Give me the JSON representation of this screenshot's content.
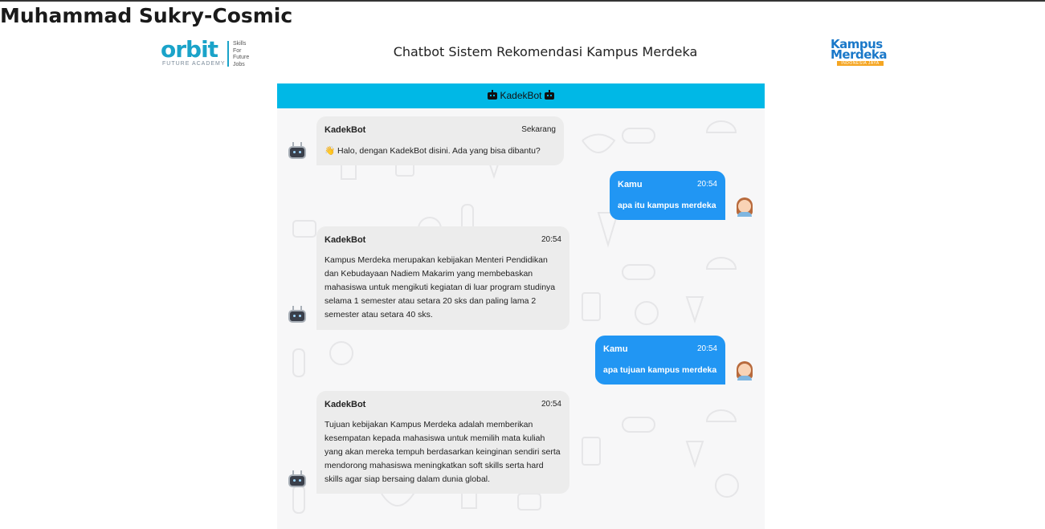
{
  "page": {
    "title": "Muhammad Sukry-Cosmic"
  },
  "header": {
    "orbit_logo": {
      "name": "orbit",
      "sub": "FUTURE ACADEMY",
      "tagline": [
        "Skills",
        "For",
        "Future",
        "Jobs"
      ]
    },
    "title": "Chatbot Sistem Rekomendasi Kampus Merdeka",
    "km_logo": {
      "line1": "Kampus",
      "line2": "Merdeka",
      "strip": "INDONESIA JAYA"
    }
  },
  "chat": {
    "header_label": "KadekBot",
    "header_icon": "robot-icon",
    "colors": {
      "header": "#00b8e6",
      "user_bubble": "#2196f3",
      "bot_bubble": "#ececec"
    },
    "messages": [
      {
        "sender": "KadekBot",
        "time": "Sekarang",
        "side": "left",
        "emoji": "👋",
        "text": "Halo, dengan KadekBot disini. Ada yang bisa dibantu?"
      },
      {
        "sender": "Kamu",
        "time": "20:54",
        "side": "right",
        "text": "apa itu kampus merdeka"
      },
      {
        "sender": "KadekBot",
        "time": "20:54",
        "side": "left",
        "text": "Kampus Merdeka merupakan kebijakan Menteri Pendidikan dan Kebudayaan Nadiem Makarim yang membebaskan mahasiswa untuk mengikuti kegiatan di luar program studinya selama 1 semester atau setara 20 sks dan paling lama 2 semester atau setara 40 sks."
      },
      {
        "sender": "Kamu",
        "time": "20:54",
        "side": "right",
        "text": "apa tujuan kampus merdeka"
      },
      {
        "sender": "KadekBot",
        "time": "20:54",
        "side": "left",
        "text": "Tujuan kebijakan Kampus Merdeka adalah memberikan kesempatan kepada mahasiswa untuk memilih mata kuliah yang akan mereka tempuh berdasarkan keinginan sendiri serta mendorong mahasiswa meningkatkan soft skills serta hard skills agar siap bersaing dalam dunia global."
      }
    ]
  }
}
